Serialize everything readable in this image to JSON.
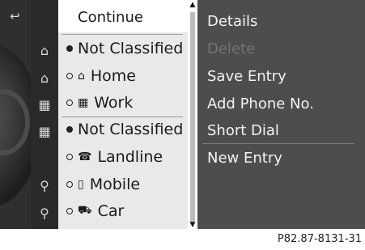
{
  "menu": {
    "continue_label": "Continue",
    "items": [
      {
        "bullet": "filled",
        "glyph": "",
        "glyph_name": "",
        "label": "Not Classified"
      },
      {
        "bullet": "open",
        "glyph": "⌂",
        "glyph_name": "home-icon",
        "label": "Home"
      },
      {
        "bullet": "open",
        "glyph": "▦",
        "glyph_name": "work-icon",
        "label": "Work"
      },
      {
        "bullet": "filled",
        "glyph": "",
        "glyph_name": "",
        "label": "Not Classified"
      },
      {
        "bullet": "open",
        "glyph": "☎",
        "glyph_name": "landline-phone-icon",
        "label": "Landline"
      },
      {
        "bullet": "open",
        "glyph": "▯",
        "glyph_name": "mobile-phone-icon",
        "label": "Mobile"
      },
      {
        "bullet": "open",
        "glyph": "⛟",
        "glyph_name": "car-phone-icon",
        "label": "Car"
      }
    ]
  },
  "options": {
    "items": [
      {
        "label": "Details",
        "enabled": true
      },
      {
        "label": "Delete",
        "enabled": false
      },
      {
        "label": "Save Entry",
        "enabled": true
      },
      {
        "label": "Add Phone No.",
        "enabled": true
      },
      {
        "label": "Short Dial",
        "enabled": true
      },
      {
        "label": "New Entry",
        "enabled": true
      }
    ]
  },
  "left_icons": {
    "back_icon": "↩",
    "contact_icon": "⚲",
    "rows": [
      "⌂",
      "⌂",
      "▦",
      "▦",
      "",
      "",
      "⚲",
      "⚲"
    ]
  },
  "footer": {
    "code": "P82.87-8131-31"
  },
  "colors": {
    "right_panel": "#4c4d4f",
    "middle_panel": "#e9e9e9",
    "disabled_text": "#717377"
  }
}
